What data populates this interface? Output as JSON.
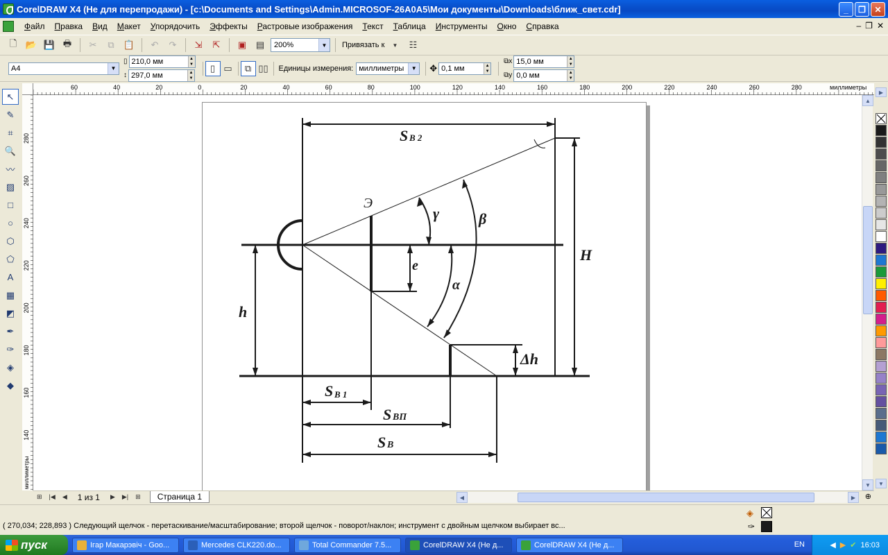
{
  "window": {
    "title": "CorelDRAW X4 (Не для перепродажи) - [c:\\Documents and Settings\\Admin.MICROSOF-26A0A5\\Мои документы\\Downloads\\ближ_свет.cdr]"
  },
  "menu": [
    "Файл",
    "Правка",
    "Вид",
    "Макет",
    "Упорядочить",
    "Эффекты",
    "Растровые изображения",
    "Текст",
    "Таблица",
    "Инструменты",
    "Окно",
    "Справка"
  ],
  "toolbar": {
    "zoom": "200%",
    "snap_label": "Привязать к"
  },
  "property_bar": {
    "paper_size": "A4",
    "width": "210,0 мм",
    "height": "297,0 мм",
    "units_label": "Единицы измерения:",
    "units_value": "миллиметры",
    "nudge": "0,1 мм",
    "dup_x": "15,0 мм",
    "dup_y": "0,0 мм"
  },
  "ruler": {
    "h_labels": [
      "60",
      "40",
      "20",
      "0",
      "20",
      "40",
      "60",
      "80",
      "100",
      "120",
      "140",
      "160",
      "180",
      "200",
      "220",
      "240",
      "260",
      "280"
    ],
    "h_units": "миллиметры",
    "v_labels": [
      "280",
      "260",
      "240",
      "220",
      "200",
      "180",
      "160",
      "140"
    ],
    "v_units": "миллиметры"
  },
  "drawing": {
    "labels": {
      "sb2_main": "S",
      "sb2_sub": "В 2",
      "e_letter": "Э",
      "gamma": "γ",
      "beta": "β",
      "H": "H",
      "h": "h",
      "e": "e",
      "alpha": "α",
      "delta_h": "Δh",
      "sb1_main": "S",
      "sb1_sub": "В 1",
      "sbp_main": "S",
      "sbp_sub": "ВП",
      "sb_main": "S",
      "sb_sub": "В"
    }
  },
  "pagenav": {
    "counter": "1 из 1",
    "page_tab": "Страница 1"
  },
  "status": {
    "text": "( 270,034; 228,893 )   Следующий щелчок - перетаскивание/масштабирование; второй щелчок - поворот/наклон; инструмент с двойным щелчком выбирает вс..."
  },
  "taskbar": {
    "start": "пуск",
    "tasks": [
      {
        "label": "Ігар Макарэвіч - Goo...",
        "color": "#e8b13a"
      },
      {
        "label": "Mercedes CLK220.do...",
        "color": "#2b5fb8"
      },
      {
        "label": "Total Commander 7.5...",
        "color": "#6fa8dc"
      },
      {
        "label": "CorelDRAW X4 (Не д...",
        "color": "#3aa23a",
        "active": true
      },
      {
        "label": "CorelDRAW X4 (Не д...",
        "color": "#3aa23a"
      }
    ],
    "lang": "EN",
    "clock": "16:03"
  },
  "palette": [
    "#1a1a1a",
    "#333333",
    "#4d4d4d",
    "#666666",
    "#808080",
    "#999999",
    "#b3b3b3",
    "#cccccc",
    "#e6e6e6",
    "#ffffff",
    "#2e1a80",
    "#1e78d2",
    "#1a9a3a",
    "#ffef00",
    "#ff5a00",
    "#e21e50",
    "#d41e8c",
    "#ff9a00",
    "#ff9a9a",
    "#8c7864",
    "#b4a0d2",
    "#9682c8",
    "#7864b4",
    "#6450a0",
    "#5a6e8c",
    "#465a78",
    "#1e78d2",
    "#1a5aaa"
  ]
}
